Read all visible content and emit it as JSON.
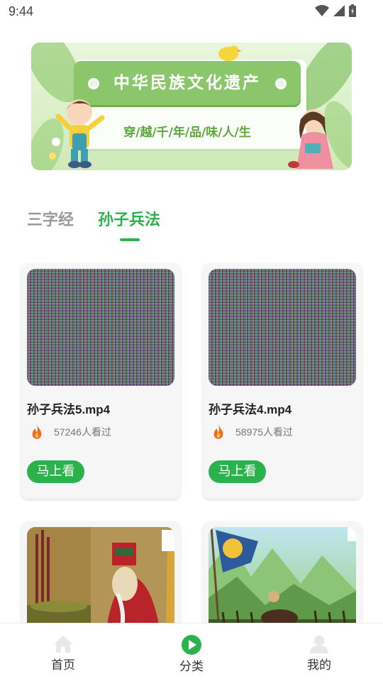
{
  "status_bar": {
    "time": "9:44"
  },
  "banner": {
    "title": "中华民族文化遗产",
    "subtitle": "穿/越/千/年/品/味/人/生"
  },
  "tabs": [
    {
      "label": "三字经",
      "active": false
    },
    {
      "label": "孙子兵法",
      "active": true
    }
  ],
  "videos": [
    {
      "title": "孙子兵法5.mp4",
      "views": "57246人看过",
      "button": "马上看"
    },
    {
      "title": "孙子兵法4.mp4",
      "views": "58975人看过",
      "button": "马上看"
    }
  ],
  "bottom_nav": [
    {
      "label": "首页",
      "icon": "home-icon"
    },
    {
      "label": "分类",
      "icon": "play-icon",
      "active": true
    },
    {
      "label": "我的",
      "icon": "user-icon"
    }
  ],
  "colors": {
    "accent": "#2bb24c",
    "inactive_tab": "#9a9a9a",
    "fire": "#f26b22"
  }
}
